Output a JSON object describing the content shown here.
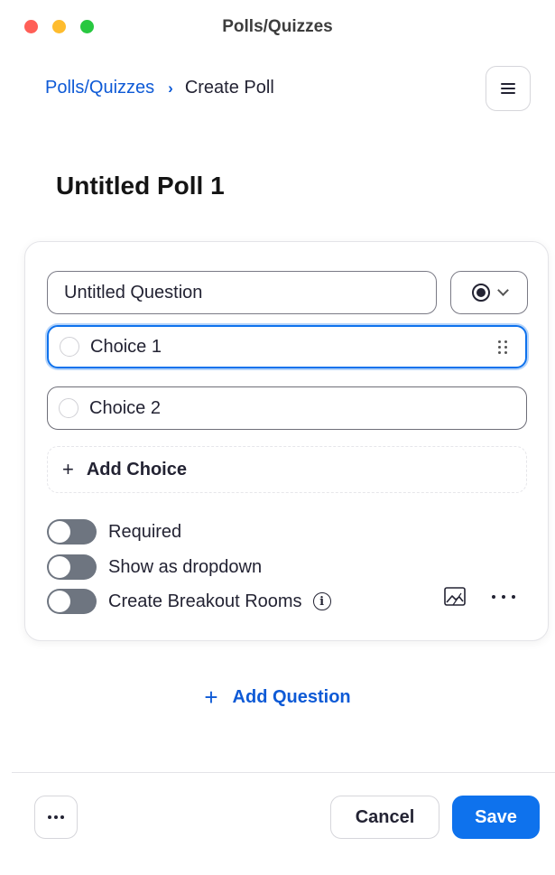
{
  "window": {
    "title": "Polls/Quizzes"
  },
  "breadcrumb": {
    "parent": "Polls/Quizzes",
    "separator": "›",
    "current": "Create Poll"
  },
  "poll": {
    "title": "Untitled Poll 1",
    "question": {
      "text": "Untitled Question",
      "type_icon": "radio-single-choice-icon",
      "choices": [
        "Choice 1",
        "Choice 2"
      ],
      "add_choice_label": "Add Choice",
      "options": [
        {
          "label": "Required",
          "enabled": false
        },
        {
          "label": "Show as dropdown",
          "enabled": false
        },
        {
          "label": "Create Breakout Rooms",
          "enabled": false
        }
      ]
    },
    "add_question_label": "Add Question"
  },
  "footer": {
    "cancel_label": "Cancel",
    "save_label": "Save"
  },
  "colors": {
    "accent": "#0e72ed",
    "link": "#0e5ad6",
    "toggle_off": "#6e7580"
  }
}
